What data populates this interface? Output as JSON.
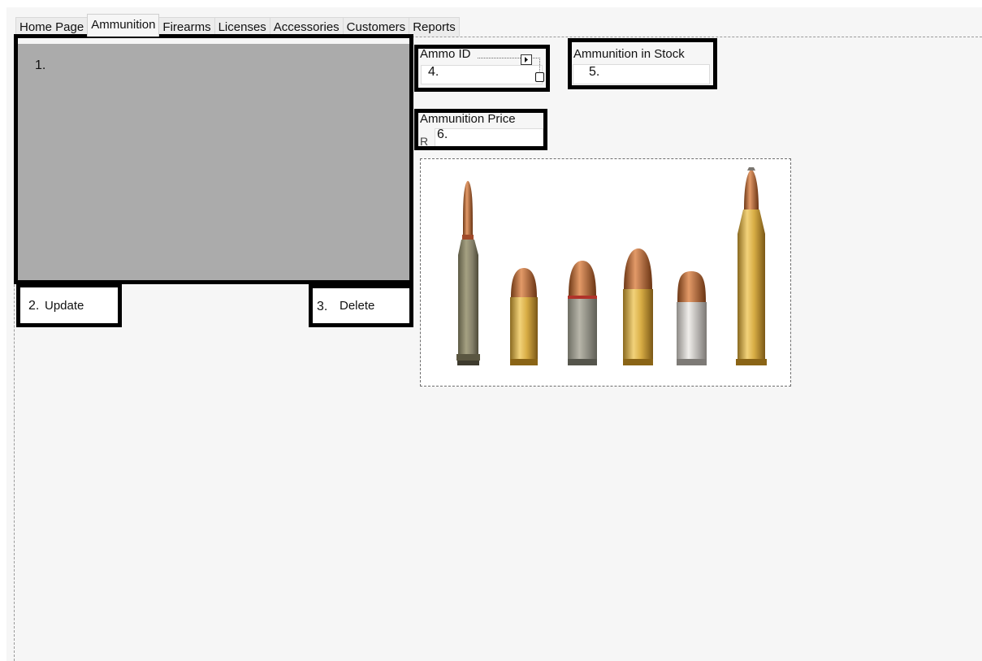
{
  "tabs": [
    {
      "label": "Home Page",
      "active": false
    },
    {
      "label": "Ammunition",
      "active": true
    },
    {
      "label": "Firearms",
      "active": false
    },
    {
      "label": "Licenses",
      "active": false
    },
    {
      "label": "Accessories",
      "active": false
    },
    {
      "label": "Customers",
      "active": false
    },
    {
      "label": "Reports",
      "active": false
    }
  ],
  "annotations": {
    "grid": "1.",
    "update": "2.",
    "delete": "3.",
    "ammo_id": "4.",
    "stock": "5.",
    "price": "6."
  },
  "buttons": {
    "update_label": "Update",
    "delete_label": "Delete"
  },
  "fields": {
    "ammo_id_label": "Ammo ID",
    "ammo_id_value": "",
    "stock_label": "Ammunition in Stock",
    "stock_value": "",
    "price_label": "Ammunition Price",
    "price_value": "",
    "price_overlap_char": "R"
  },
  "image": {
    "subject": "ammunition-cartridges-icon"
  },
  "colors": {
    "grid_placeholder": "#ababab",
    "annotation_border": "#000000",
    "background": "#f6f6f6"
  }
}
